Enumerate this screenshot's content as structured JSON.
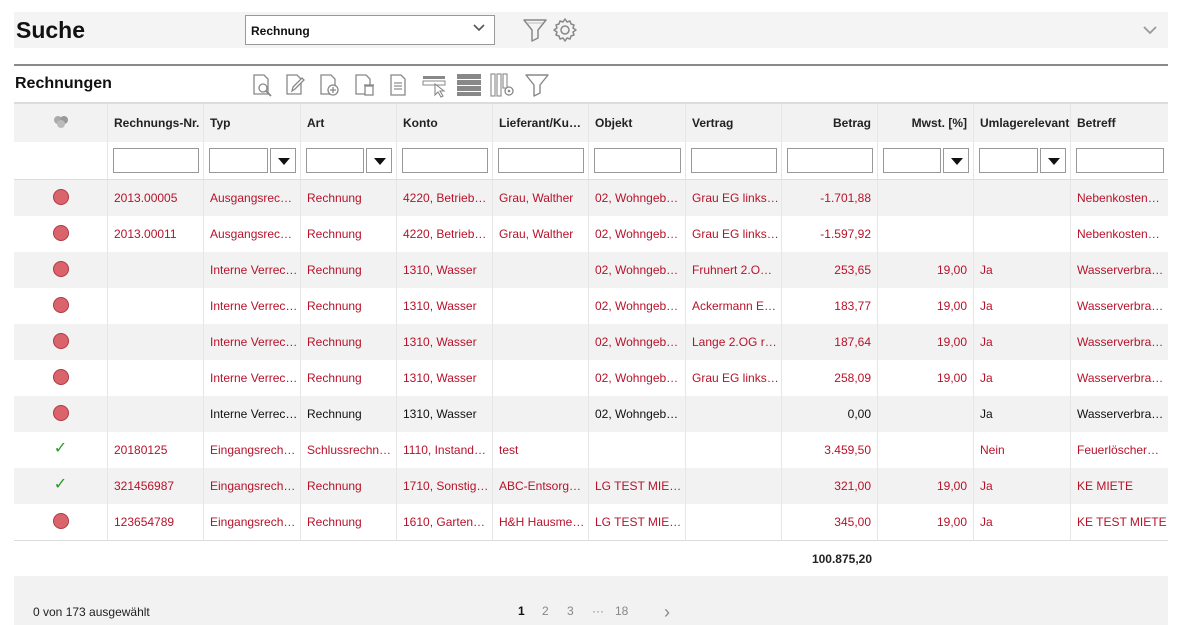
{
  "search": {
    "title": "Suche",
    "selected_query": "Rechnung"
  },
  "section": {
    "title": "Rechnungen"
  },
  "columns": [
    {
      "label": "",
      "align": "center"
    },
    {
      "label": "Rechnungs-Nr.",
      "align": "left"
    },
    {
      "label": "Typ",
      "align": "left"
    },
    {
      "label": "Art",
      "align": "left"
    },
    {
      "label": "Konto",
      "align": "left"
    },
    {
      "label": "Lieferant/Kun…",
      "align": "left"
    },
    {
      "label": "Objekt",
      "align": "left"
    },
    {
      "label": "Vertrag",
      "align": "left"
    },
    {
      "label": "Betrag",
      "align": "right"
    },
    {
      "label": "Mwst. [%]",
      "align": "right"
    },
    {
      "label": "Umlagerelevant",
      "align": "left"
    },
    {
      "label": "Betreff",
      "align": "left"
    }
  ],
  "filters": [
    "none",
    "input",
    "combo",
    "combo",
    "input",
    "input",
    "input",
    "input",
    "input",
    "combo",
    "combo",
    "input"
  ],
  "rows": [
    {
      "status": "open",
      "color": "red",
      "cells": [
        "2013.00005",
        "Ausgangsrec…",
        "Rechnung",
        "4220, Betrieb…",
        "Grau, Walther",
        "02, Wohngeb…",
        "Grau EG links…",
        "-1.701,88",
        "",
        "",
        "Nebenkosten…"
      ]
    },
    {
      "status": "open",
      "color": "red",
      "cells": [
        "2013.00011",
        "Ausgangsrec…",
        "Rechnung",
        "4220, Betrieb…",
        "Grau, Walther",
        "02, Wohngeb…",
        "Grau EG links…",
        "-1.597,92",
        "",
        "",
        "Nebenkosten…"
      ]
    },
    {
      "status": "open",
      "color": "red",
      "cells": [
        "",
        "Interne Verrec…",
        "Rechnung",
        "1310, Wasser",
        "",
        "02, Wohngeb…",
        "Fruhnert 2.OG…",
        "253,65",
        "19,00",
        "Ja",
        "Wasserverbra…"
      ]
    },
    {
      "status": "open",
      "color": "red",
      "cells": [
        "",
        "Interne Verrec…",
        "Rechnung",
        "1310, Wasser",
        "",
        "02, Wohngeb…",
        "Ackermann E…",
        "183,77",
        "19,00",
        "Ja",
        "Wasserverbra…"
      ]
    },
    {
      "status": "open",
      "color": "red",
      "cells": [
        "",
        "Interne Verrec…",
        "Rechnung",
        "1310, Wasser",
        "",
        "02, Wohngeb…",
        "Lange 2.OG r…",
        "187,64",
        "19,00",
        "Ja",
        "Wasserverbra…"
      ]
    },
    {
      "status": "open",
      "color": "red",
      "cells": [
        "",
        "Interne Verrec…",
        "Rechnung",
        "1310, Wasser",
        "",
        "02, Wohngeb…",
        "Grau EG links…",
        "258,09",
        "19,00",
        "Ja",
        "Wasserverbra…"
      ]
    },
    {
      "status": "open",
      "color": "black",
      "cells": [
        "",
        "Interne Verrec…",
        "Rechnung",
        "1310, Wasser",
        "",
        "02, Wohngeb…",
        "",
        "0,00",
        "",
        "Ja",
        "Wasserverbra…"
      ]
    },
    {
      "status": "done",
      "color": "red",
      "cells": [
        "20180125",
        "Eingangsrech…",
        "Schlussrechn…",
        "1110, Instand…",
        "test",
        "",
        "",
        "3.459,50",
        "",
        "Nein",
        "Feuerlöscher…"
      ]
    },
    {
      "status": "done",
      "color": "red",
      "cells": [
        "321456987",
        "Eingangsrech…",
        "Rechnung",
        "1710, Sonstig…",
        "ABC-Entsorg…",
        "LG TEST MIE…",
        "",
        "321,00",
        "19,00",
        "Ja",
        "KE MIETE"
      ]
    },
    {
      "status": "open",
      "color": "red",
      "cells": [
        "123654789",
        "Eingangsrech…",
        "Rechnung",
        "1610, Garten…",
        "H&H Hausme…",
        "LG TEST MIE…",
        "",
        "345,00",
        "19,00",
        "Ja",
        "KE TEST MIETE"
      ]
    }
  ],
  "total": "100.875,20",
  "footer": {
    "selection_info": "0 von 173 ausgewählt",
    "pages": [
      "1",
      "2",
      "3",
      "···",
      "18"
    ],
    "current_page": "1",
    "next_symbol": "›"
  },
  "colors": {
    "accent_red": "#b8122a",
    "status_dot": "#d9646b",
    "check_green": "#2a9a2a"
  }
}
